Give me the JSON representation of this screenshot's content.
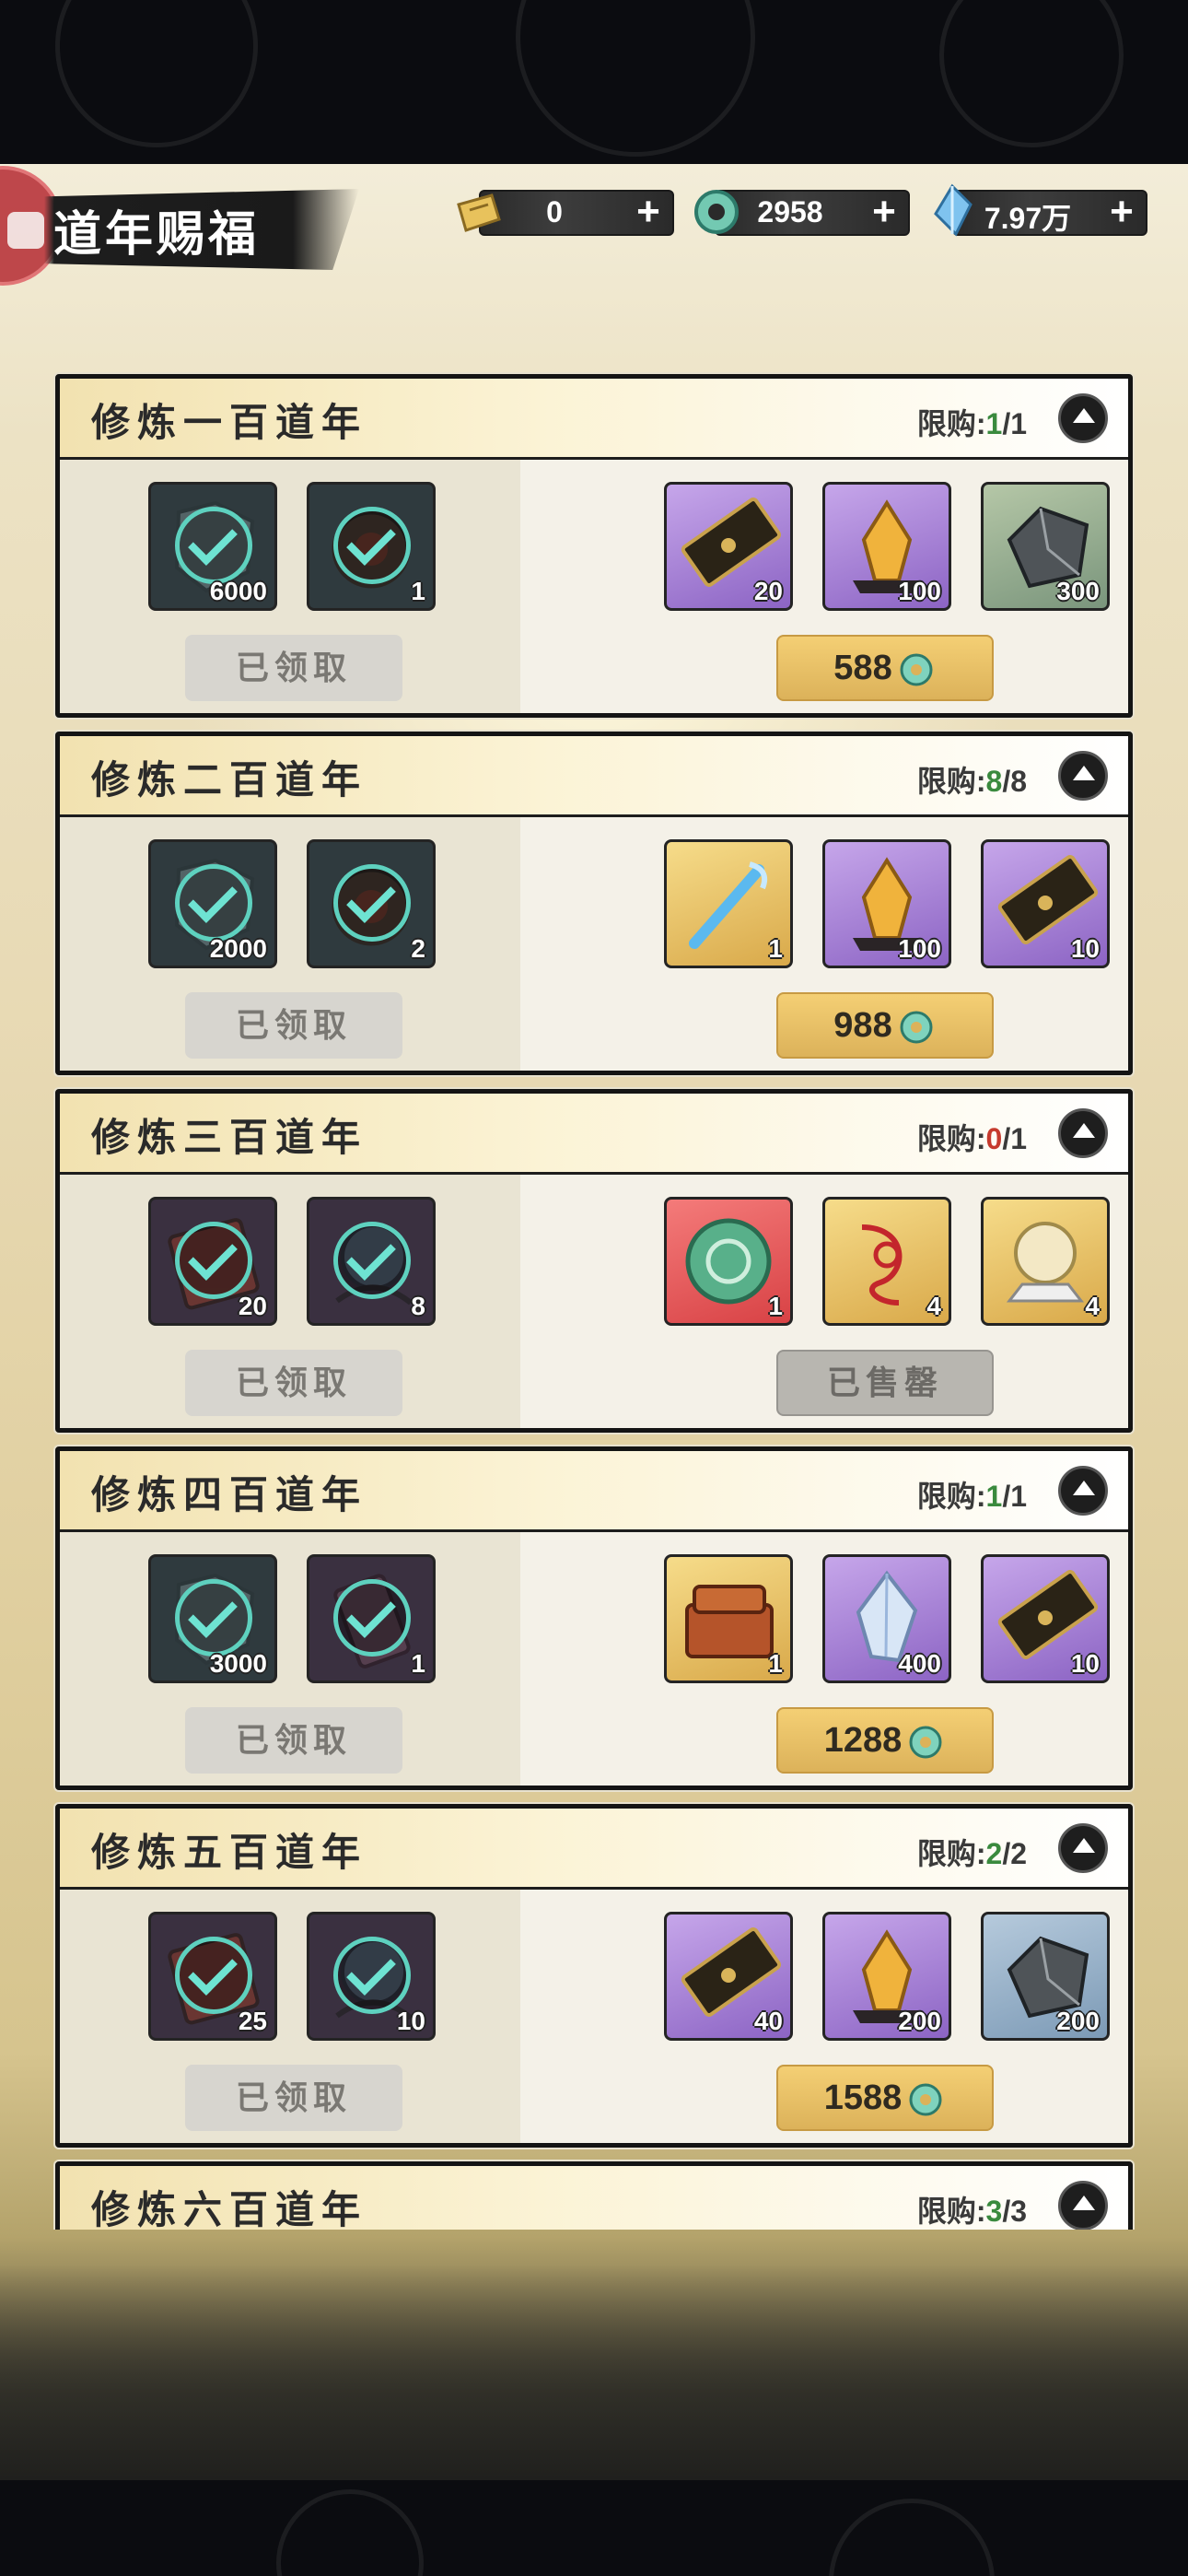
{
  "header": {
    "title": "道年赐福",
    "currencies": [
      {
        "icon": "gold-ticket-icon",
        "value": "0"
      },
      {
        "icon": "jade-ring-icon",
        "value": "2958"
      },
      {
        "icon": "spirit-crystal-icon",
        "value": "7.97万"
      }
    ],
    "plus_symbol": "+"
  },
  "claimed_label": "已领取",
  "sold_out_label": "已售罄",
  "limit_prefix": "限购:",
  "tiers": [
    {
      "title": "修炼一百道年",
      "limit_used": "1",
      "limit_total": "1",
      "limit_color": "g",
      "free_items": [
        {
          "icon": "spirit-stone-icon",
          "qty": "6000"
        },
        {
          "icon": "demon-gear-icon",
          "qty": "1"
        }
      ],
      "paid_items": [
        {
          "icon": "token-plate-icon",
          "qty": "20",
          "rarity": "purple"
        },
        {
          "icon": "gold-crystal-icon",
          "qty": "100",
          "rarity": "purple"
        },
        {
          "icon": "iron-ore-icon",
          "qty": "300",
          "rarity": "green"
        }
      ],
      "price": "588",
      "sold_out": false
    },
    {
      "title": "修炼二百道年",
      "limit_used": "8",
      "limit_total": "8",
      "limit_color": "g",
      "free_items": [
        {
          "icon": "spirit-stone-icon",
          "qty": "2000"
        },
        {
          "icon": "demon-gear-icon",
          "qty": "2"
        }
      ],
      "paid_items": [
        {
          "icon": "sword-spirit-icon",
          "qty": "1",
          "rarity": "gold"
        },
        {
          "icon": "gold-crystal-icon",
          "qty": "100",
          "rarity": "purple"
        },
        {
          "icon": "token-plate-icon",
          "qty": "10",
          "rarity": "purple"
        }
      ],
      "price": "988",
      "sold_out": false
    },
    {
      "title": "修炼三百道年",
      "limit_used": "0",
      "limit_total": "1",
      "limit_color": "r",
      "free_items": [
        {
          "icon": "scroll-icon",
          "qty": "20"
        },
        {
          "icon": "spirit-orb-icon",
          "qty": "8"
        }
      ],
      "paid_items": [
        {
          "icon": "jade-disc-icon",
          "qty": "1",
          "rarity": "red"
        },
        {
          "icon": "red-cord-icon",
          "qty": "4",
          "rarity": "gold"
        },
        {
          "icon": "crystal-ball-icon",
          "qty": "4",
          "rarity": "gold"
        }
      ],
      "price": "",
      "sold_out": true
    },
    {
      "title": "修炼四百道年",
      "limit_used": "1",
      "limit_total": "1",
      "limit_color": "g",
      "free_items": [
        {
          "icon": "spirit-stone-icon",
          "qty": "3000"
        },
        {
          "icon": "talisman-icon",
          "qty": "1"
        }
      ],
      "paid_items": [
        {
          "icon": "treasure-chest-icon",
          "qty": "1",
          "rarity": "gold"
        },
        {
          "icon": "ice-crystal-icon",
          "qty": "400",
          "rarity": "purple"
        },
        {
          "icon": "token-plate-icon",
          "qty": "10",
          "rarity": "purple"
        }
      ],
      "price": "1288",
      "sold_out": false
    },
    {
      "title": "修炼五百道年",
      "limit_used": "2",
      "limit_total": "2",
      "limit_color": "g",
      "free_items": [
        {
          "icon": "scroll-icon",
          "qty": "25"
        },
        {
          "icon": "spirit-orb-icon",
          "qty": "10"
        }
      ],
      "paid_items": [
        {
          "icon": "token-plate-icon",
          "qty": "40",
          "rarity": "purple"
        },
        {
          "icon": "gold-crystal-icon",
          "qty": "200",
          "rarity": "purple"
        },
        {
          "icon": "iron-ore-icon",
          "qty": "200",
          "rarity": "blue"
        }
      ],
      "price": "1588",
      "sold_out": false
    },
    {
      "title": "修炼六百道年",
      "limit_used": "3",
      "limit_total": "3",
      "limit_color": "g"
    }
  ]
}
